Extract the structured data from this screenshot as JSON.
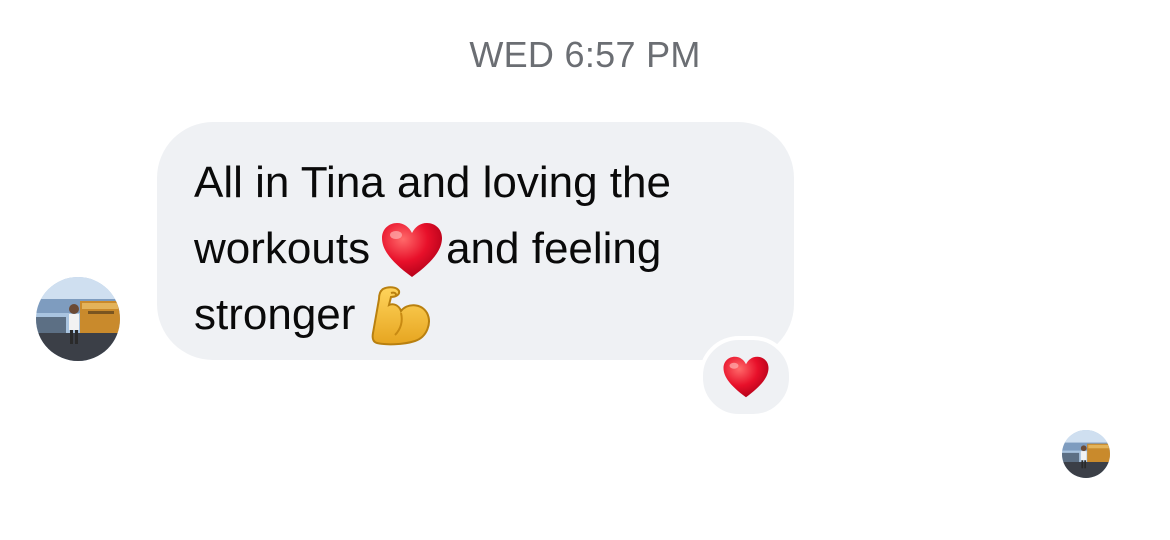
{
  "conversation": {
    "timestamp": "WED 6:57 PM",
    "message": {
      "line1": "All in Tina and loving the",
      "line2_before": "workouts",
      "line2_after": "and feeling",
      "line3": "stronger",
      "emojis": [
        "red-heart",
        "flexed-biceps"
      ]
    },
    "reaction": {
      "emoji": "red-heart"
    },
    "sender_avatar": "avatar-photo",
    "read_receipt_avatar": "avatar-photo"
  },
  "colors": {
    "bubble": "#eff1f4",
    "timestamp": "#6b6e73",
    "text": "#0a0a0a",
    "heart": "#e8102a"
  }
}
